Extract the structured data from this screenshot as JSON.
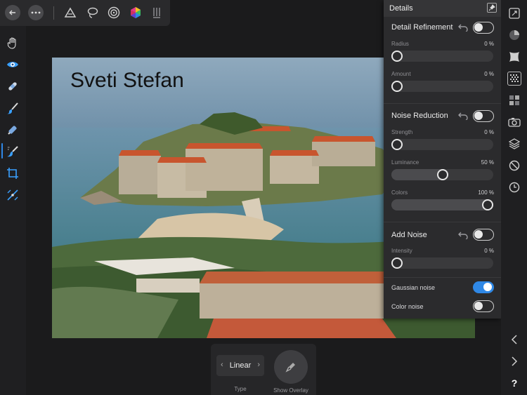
{
  "photo": {
    "caption": "Sveti Stefan"
  },
  "panel": {
    "title": "Details",
    "detail_refinement": {
      "title": "Detail Refinement",
      "enabled": false,
      "radius": {
        "label": "Radius",
        "value": "0 %",
        "level": 0
      },
      "amount": {
        "label": "Amount",
        "value": "0 %",
        "level": 0
      }
    },
    "noise_reduction": {
      "title": "Noise Reduction",
      "enabled": false,
      "strength": {
        "label": "Strength",
        "value": "0 %",
        "level": 0
      },
      "luminance": {
        "label": "Luminance",
        "value": "50 %",
        "level": 50
      },
      "colors": {
        "label": "Colors",
        "value": "100 %",
        "level": 100
      }
    },
    "add_noise": {
      "title": "Add Noise",
      "enabled": false,
      "intensity": {
        "label": "Intensity",
        "value": "0 %",
        "level": 0
      },
      "gaussian": {
        "label": "Gaussian noise",
        "enabled": true
      },
      "color_noise": {
        "label": "Color noise",
        "enabled": false
      }
    }
  },
  "context_bar": {
    "type_value": "Linear",
    "type_label": "Type",
    "overlay_label": "Show Overlay"
  },
  "right_bar": {
    "help": "?"
  },
  "colors": {
    "accent": "#2f88e6",
    "panel_bg": "#2b2b2d",
    "app_bg": "#1b1b1c"
  }
}
